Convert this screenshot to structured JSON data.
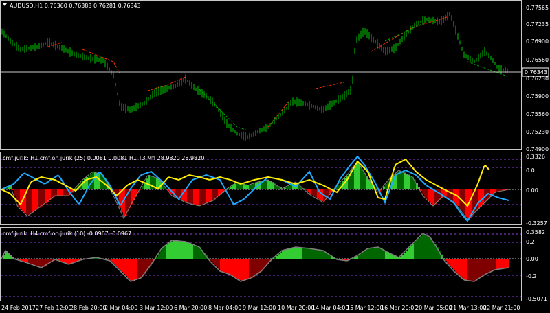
{
  "symbol_menu_icon": "dropdown-triangle-icon",
  "main": {
    "title": "AUDUSD,H1  0.76360 0.76383 0.76281 0.76343",
    "price_ticks": [
      "0.77565",
      "0.77235",
      "0.76900",
      "0.76560",
      "0.76230",
      "0.75900",
      "0.75560",
      "0.75230",
      "0.74900"
    ],
    "current_price": "0.76343"
  },
  "indicator1": {
    "title": "cmf jurik: H1   cmf on jurik (25) 0.0081 0.0081   H1  T3 Mfi  28.9820 28.9820",
    "ticks": [
      "0.3326",
      "0.0",
      "0.00",
      "-0.3257"
    ]
  },
  "indicator2": {
    "title": "cmf jurik: H4   cmf on jurik (10) -0.0967 -0.0967",
    "ticks": [
      "0.3582",
      "0.2",
      "0.00",
      "-0.2",
      "-0.5071"
    ]
  },
  "time_axis": [
    "24 Feb 2017",
    "27 Feb 12:00",
    "28 Feb 20:00",
    "2 Mar 04:00",
    "3 Mar 12:00",
    "6 Mar 20:00",
    "8 Mar 04:00",
    "9 Mar 12:00",
    "10 Mar 20:00",
    "14 Mar 04:00",
    "15 Mar 12:00",
    "16 Mar 20:00",
    "20 Mar 05:00",
    "21 Mar 13:00",
    "22 Mar 21:00"
  ],
  "colors": {
    "background": "#000000",
    "candle": "#00cc00",
    "axis": "#ffffff",
    "level_line": "#8a3fd6",
    "trend_red": "#ff3300",
    "trend_green": "#00aa00",
    "hist_green_light": "#33cc33",
    "hist_green_dark": "#006600",
    "hist_red_light": "#ff0000",
    "hist_red_dark": "#800000",
    "osc_blue": "#1eaaff",
    "osc_yellow": "#ffee00"
  }
}
